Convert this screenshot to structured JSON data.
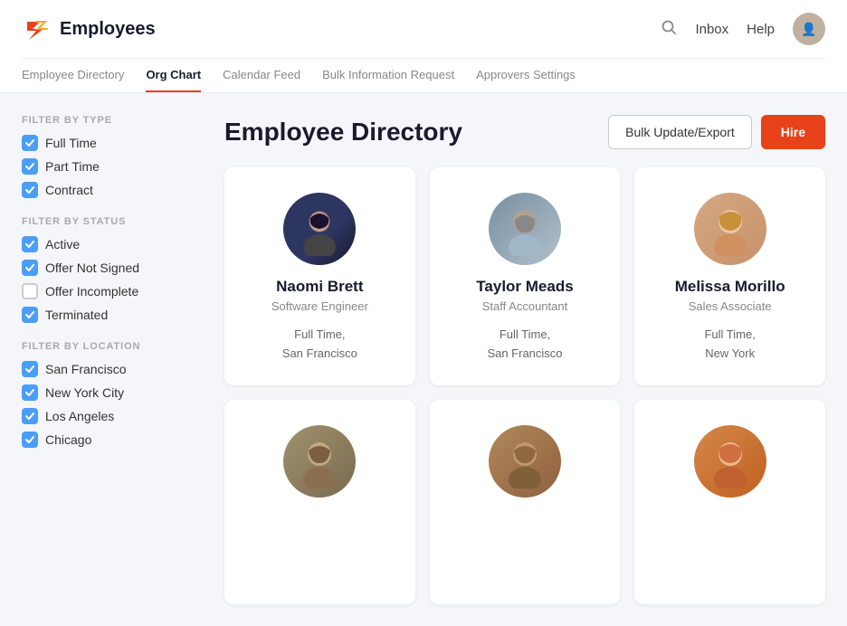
{
  "header": {
    "logo_text": "Employees",
    "nav_items": [
      {
        "label": "Employee Directory",
        "active": false
      },
      {
        "label": "Org Chart",
        "active": true
      },
      {
        "label": "Calendar Feed",
        "active": false
      },
      {
        "label": "Bulk Information Request",
        "active": false
      },
      {
        "label": "Approvers Settings",
        "active": false
      }
    ],
    "inbox_label": "Inbox",
    "help_label": "Help"
  },
  "page": {
    "title": "Employee Directory",
    "bulk_button": "Bulk Update/Export",
    "hire_button": "Hire"
  },
  "filters": {
    "by_type_title": "FILTER BY TYPE",
    "type_items": [
      {
        "label": "Full Time",
        "checked": true
      },
      {
        "label": "Part Time",
        "checked": true
      },
      {
        "label": "Contract",
        "checked": true
      }
    ],
    "by_status_title": "FILTER BY STATUS",
    "status_items": [
      {
        "label": "Active",
        "checked": true
      },
      {
        "label": "Offer Not Signed",
        "checked": true
      },
      {
        "label": "Offer Incomplete",
        "checked": false
      },
      {
        "label": "Terminated",
        "checked": true
      }
    ],
    "by_location_title": "FILTER BY LOCATION",
    "location_items": [
      {
        "label": "San Francisco",
        "checked": true
      },
      {
        "label": "New York City",
        "checked": true
      },
      {
        "label": "Los Angeles",
        "checked": true
      },
      {
        "label": "Chicago",
        "checked": true
      }
    ]
  },
  "employees": [
    {
      "name": "Naomi Brett",
      "role": "Software Engineer",
      "type": "Full Time,",
      "location": "San Francisco",
      "avatar_class": "av-naomi"
    },
    {
      "name": "Taylor Meads",
      "role": "Staff Accountant",
      "type": "Full Time,",
      "location": "San Francisco",
      "avatar_class": "av-taylor"
    },
    {
      "name": "Melissa Morillo",
      "role": "Sales Associate",
      "type": "Full Time,",
      "location": "New York",
      "avatar_class": "av-melissa"
    },
    {
      "name": "",
      "role": "",
      "type": "",
      "location": "",
      "avatar_class": "av-p4"
    },
    {
      "name": "",
      "role": "",
      "type": "",
      "location": "",
      "avatar_class": "av-p5"
    },
    {
      "name": "",
      "role": "",
      "type": "",
      "location": "",
      "avatar_class": "av-p6"
    }
  ]
}
